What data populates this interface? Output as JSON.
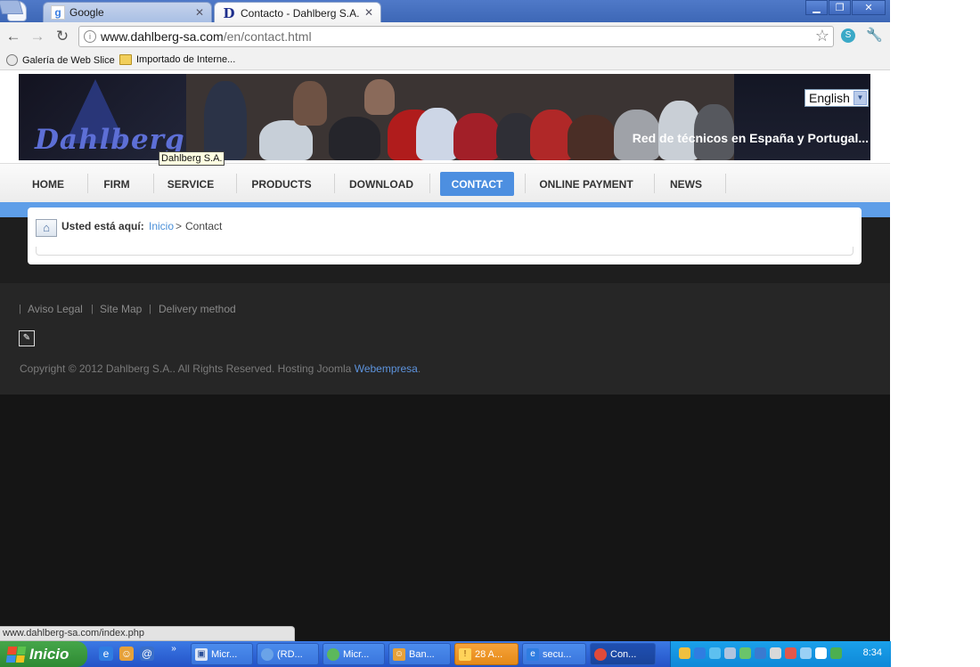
{
  "browser": {
    "tabs": [
      {
        "title": "Google",
        "favicon": "google-icon",
        "active": false
      },
      {
        "title": "Contacto - Dahlberg S.A.",
        "favicon": "dahlberg-d-icon",
        "active": true
      }
    ],
    "address": {
      "host": "www.dahlberg-sa.com",
      "path": "/en/contact.html"
    },
    "bookmarks": [
      {
        "label": "Galería de Web Slice",
        "icon": "web-slice-icon"
      },
      {
        "label": "Importado de Interne...",
        "icon": "folder-icon"
      }
    ],
    "status_url": "www.dahlberg-sa.com/index.php"
  },
  "site": {
    "logo_text": "Dahlberg",
    "tagline": "Red de técnicos en España y Portugal...",
    "language": "English",
    "logo_tooltip": "Dahlberg S.A.",
    "nav": [
      "HOME",
      "FIRM",
      "SERVICE",
      "PRODUCTS",
      "DOWNLOAD",
      "CONTACT",
      "ONLINE PAYMENT",
      "NEWS"
    ],
    "active_nav": "CONTACT",
    "breadcrumb": {
      "label": "Usted está aquí:",
      "link": "Inicio",
      "separator": ">",
      "current": "Contact"
    },
    "footer": {
      "links": [
        "Aviso Legal",
        "Site Map",
        "Delivery method"
      ],
      "copyright_prefix": "Copyright © 2012 Dahlberg S.A.. All Rights Reserved. Hosting Joomla",
      "copyright_link": "Webempresa",
      "copyright_suffix": "."
    }
  },
  "taskbar": {
    "start_label": "Inicio",
    "tasks": [
      "Micr...",
      "(RD...",
      "Micr...",
      "Ban...",
      "28 A...",
      "secu...",
      "Con..."
    ],
    "clock": "8:34"
  },
  "colors": {
    "accent": "#4d8fe0",
    "blue_bar": "#5e9ee8",
    "link": "#4a8fd8",
    "footer_link": "#5d93dc"
  }
}
